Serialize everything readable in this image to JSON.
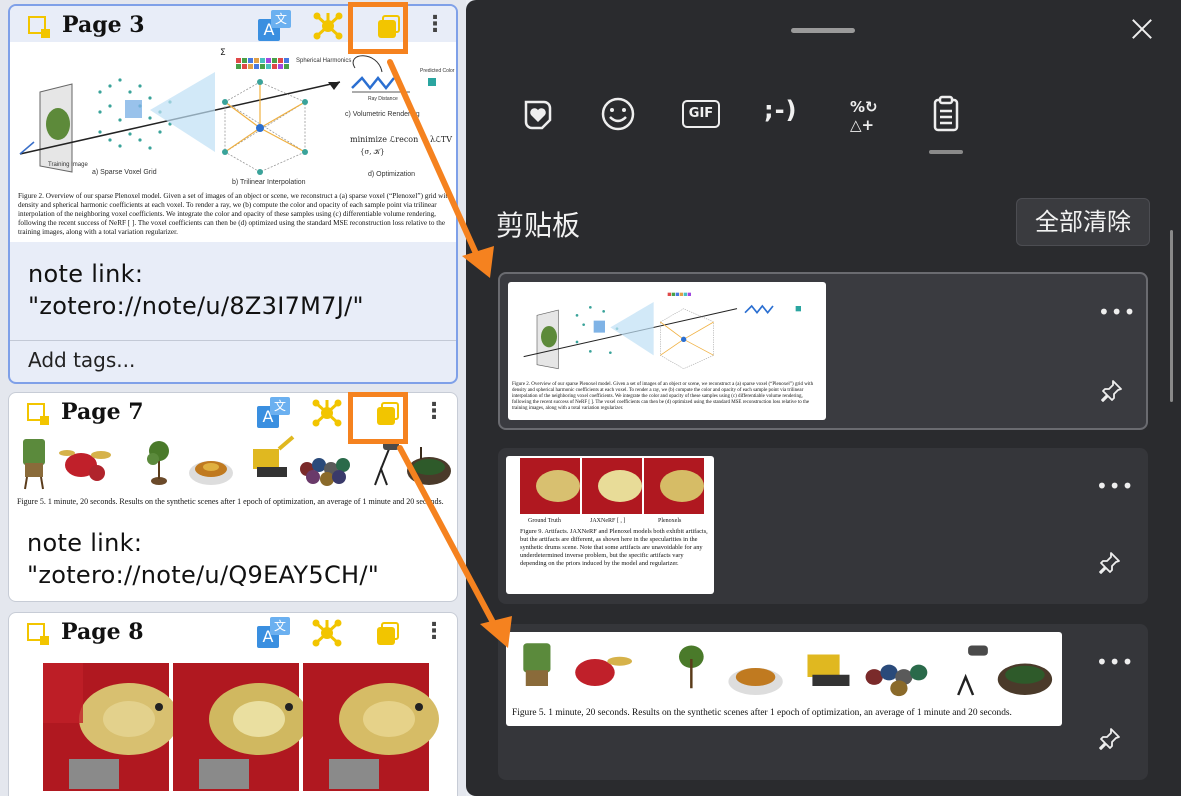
{
  "cards": [
    {
      "page_label": "Page 3",
      "figure_caption": "Figure 2. Overview of our sparse Plenoxel model. Given a set of images of an object or scene, we reconstruct a (a) sparse voxel (“Plenoxel”) grid with density and spherical harmonic coefficients at each voxel. To render a ray, we (b) compute the color and opacity of each sample point via trilinear interpolation of the neighboring voxel coefficients. We integrate the color and opacity of these samples using (c) differentiable volume rendering, following the recent success of NeRF [ ]. The voxel coefficients can then be (d) optimized using the standard MSE reconstruction loss relative to the training images, along with a total variation regularizer.",
      "fig_labels": {
        "training": "Training Image",
        "a": "a) Sparse Voxel Grid",
        "b": "b) Trilinear Interpolation",
        "c": "c) Volumetric Rendering",
        "d": "d) Optimization",
        "sh": "Spherical Harmonics",
        "predicted": "Predicted Color",
        "ray": "Ray Distance",
        "minimize": "minimize ℒrecon + λℒTV",
        "sigma": "{σ, 𝒦}",
        "sum": "Σ"
      },
      "note": "note link: \"zotero://note/u/8Z3I7M7J/\"",
      "add_tags": "Add tags..."
    },
    {
      "page_label": "Page 7",
      "figure_caption": "Figure 5. 1 minute, 20 seconds. Results on the synthetic scenes after 1 epoch of optimization, an average of 1 minute and 20 seconds.",
      "note": "note link: \"zotero://note/u/Q9EAY5CH/\""
    },
    {
      "page_label": "Page 8"
    }
  ],
  "clipboard": {
    "tabs": [
      {
        "name": "favorites",
        "icon": "heart-sticker-icon"
      },
      {
        "name": "emoji",
        "icon": "smiley-icon"
      },
      {
        "name": "gif",
        "icon": "gif-icon",
        "label": "GIF"
      },
      {
        "name": "kaomoji",
        "icon": "kaomoji-icon",
        "label": ";-)"
      },
      {
        "name": "symbols",
        "icon": "symbols-icon",
        "label": "%↻\n△+"
      },
      {
        "name": "clipboard",
        "icon": "clipboard-icon"
      }
    ],
    "title": "剪贴板",
    "clear_all": "全部清除",
    "items": [
      {
        "kind": "image",
        "desc": "Plenoxel overview figure"
      },
      {
        "kind": "image",
        "labels": [
          "Ground Truth",
          "JAXNeRF [  ,  ]",
          "Plenoxels"
        ],
        "caption": "Figure 9. Artifacts. JAXNeRF and Plenoxel models both exhibit artifacts, but the artifacts are different, as shown here in the specularities in the synthetic drums scene. Note that some artifacts are unavoidable for any underdetermined inverse problem, but the specific artifacts vary depending on the priors induced by the model and regularizer."
      },
      {
        "kind": "image",
        "desc": "synthetic scenes strip"
      }
    ]
  },
  "colors": {
    "accent_orange": "#f5821f",
    "highlight_yellow": "#f2c500",
    "translate_blue": "#3a8fe0",
    "panel_bg": "#2a2b2e"
  }
}
